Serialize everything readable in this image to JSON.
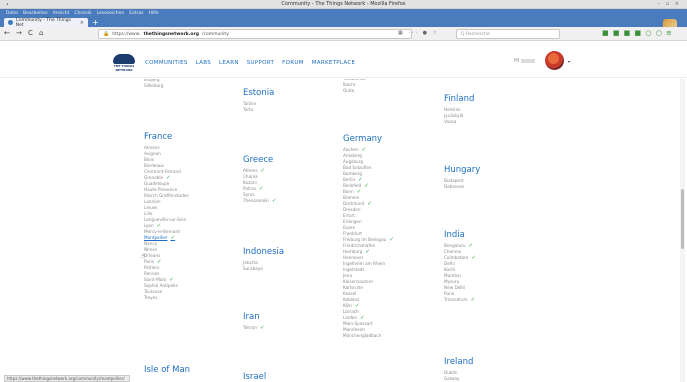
{
  "window": {
    "title": "Community - The Things Network - Mozilla Firefox",
    "controls": "– ▫ ×"
  },
  "menubar": {
    "items": [
      "Datei",
      "Bearbeiten",
      "Ansicht",
      "Chronik",
      "Lesezeichen",
      "Extras",
      "Hilfe"
    ]
  },
  "tab": {
    "label": "Community - The Things Net",
    "close": "×",
    "new": "+"
  },
  "navbar": {
    "back": "←",
    "forward": "→",
    "reload": "C",
    "home": "⌂",
    "url_prefix": "https://www.",
    "url_host": "thethingsnetwork.org",
    "url_path": "/community",
    "url_icons": "▦ ··· ● ☆",
    "search_placeholder": "Q Recherche",
    "tools": "■ ■ ■ ■ ○ ○ ≡"
  },
  "site": {
    "logo_text": "THE THINGS NETWORK",
    "nav": [
      "COMMUNITIES",
      "LABS",
      "LEARN",
      "SUPPORT",
      "FORUM",
      "MARKETPLACE"
    ],
    "user_greeting": "HI",
    "caret": "▾"
  },
  "columns": [
    {
      "blocks": [
        {
          "country": "",
          "cities": [
            {
              "name": "Esbjerg"
            },
            {
              "name": "Silkeborg"
            }
          ]
        },
        {
          "country": "France",
          "cities": [
            {
              "name": "Amiens"
            },
            {
              "name": "Avignon"
            },
            {
              "name": "Blois"
            },
            {
              "name": "Bordeaux"
            },
            {
              "name": "Clermont-Ferrand"
            },
            {
              "name": "Grenoble",
              "check": true
            },
            {
              "name": "Guadeloupe"
            },
            {
              "name": "Haute Provence"
            },
            {
              "name": "Illkirch Graffenstaden"
            },
            {
              "name": "Lannion"
            },
            {
              "name": "Lieues"
            },
            {
              "name": "Lille"
            },
            {
              "name": "Longueville-sur-Scie"
            },
            {
              "name": "Lyon",
              "check": true
            },
            {
              "name": "Mercy-le-Bernard"
            },
            {
              "name": "Montpellier",
              "check": true,
              "hl": true
            },
            {
              "name": "Nancy"
            },
            {
              "name": "Nîmes"
            },
            {
              "name": "Orleans"
            },
            {
              "name": "Paris",
              "check": true
            },
            {
              "name": "Poitiers"
            },
            {
              "name": "Rennes"
            },
            {
              "name": "Saint-Malo",
              "check": true
            },
            {
              "name": "Sophia Antipolis"
            },
            {
              "name": "Toulouse"
            },
            {
              "name": "Troyes"
            }
          ]
        },
        {
          "country": "Isle of Man",
          "cities": []
        }
      ]
    },
    {
      "blocks": [
        {
          "country": "Estonia",
          "cities": [
            {
              "name": "Tallinn"
            },
            {
              "name": "Tartu"
            }
          ]
        },
        {
          "country": "Greece",
          "cities": [
            {
              "name": "Athens",
              "check": true
            },
            {
              "name": "Chania"
            },
            {
              "name": "Kozani"
            },
            {
              "name": "Patras",
              "check": true
            },
            {
              "name": "Syros"
            },
            {
              "name": "Thessaloniki",
              "check": true
            }
          ]
        },
        {
          "country": "Indonesia",
          "cities": [
            {
              "name": "Jakarta"
            },
            {
              "name": "Surabaya"
            }
          ]
        },
        {
          "country": "Iran",
          "cities": [
            {
              "name": "Tehran",
              "check": true
            }
          ]
        },
        {
          "country": "Israel",
          "cities": []
        }
      ]
    },
    {
      "blocks": [
        {
          "country": "",
          "cities": [
            {
              "name": "Tessaloniki"
            },
            {
              "name": "Ibarra"
            },
            {
              "name": "Quito"
            }
          ]
        },
        {
          "country": "Germany",
          "cities": [
            {
              "name": "Aachen",
              "check": true
            },
            {
              "name": "Arnsberg"
            },
            {
              "name": "Augsburg"
            },
            {
              "name": "Bad Salzuflen"
            },
            {
              "name": "Bamberg"
            },
            {
              "name": "Berlin",
              "check": true
            },
            {
              "name": "Bielefeld",
              "check": true
            },
            {
              "name": "Bonn",
              "check": true
            },
            {
              "name": "Bremen"
            },
            {
              "name": "Dortmund",
              "check": true
            },
            {
              "name": "Dresden"
            },
            {
              "name": "Erfurt"
            },
            {
              "name": "Erlangen"
            },
            {
              "name": "Essen"
            },
            {
              "name": "Frankfurt"
            },
            {
              "name": "Freiburg im Breisgau",
              "check": true
            },
            {
              "name": "Friedrichshafen"
            },
            {
              "name": "Hamburg",
              "check": true
            },
            {
              "name": "Hannover"
            },
            {
              "name": "Ingelheim am Rhein"
            },
            {
              "name": "Ingolstadt"
            },
            {
              "name": "Jena"
            },
            {
              "name": "Kaiserslautern"
            },
            {
              "name": "Karlsruhe"
            },
            {
              "name": "Kassel"
            },
            {
              "name": "Koblenz"
            },
            {
              "name": "Köln",
              "check": true
            },
            {
              "name": "Lörrach"
            },
            {
              "name": "Linden",
              "check": true
            },
            {
              "name": "Main-Spessart"
            },
            {
              "name": "Mannheim"
            },
            {
              "name": "Mönchengladbach"
            }
          ]
        }
      ]
    },
    {
      "blocks": [
        {
          "country": "Finland",
          "cities": [
            {
              "name": "Helsinki"
            },
            {
              "name": "Jyväskylä"
            },
            {
              "name": "Vaasa"
            }
          ]
        },
        {
          "country": "Hungary",
          "cities": [
            {
              "name": "Budapest"
            },
            {
              "name": "Debrecen"
            }
          ]
        },
        {
          "country": "India",
          "cities": [
            {
              "name": "Bengaluru",
              "check": true
            },
            {
              "name": "Chennai"
            },
            {
              "name": "Coimbatore",
              "check": true
            },
            {
              "name": "Delhi"
            },
            {
              "name": "Kochi"
            },
            {
              "name": "Mumbai"
            },
            {
              "name": "Mysuru"
            },
            {
              "name": "New Delhi"
            },
            {
              "name": "Pune"
            },
            {
              "name": "Trivandrum",
              "check": true
            }
          ]
        },
        {
          "country": "Ireland",
          "cities": [
            {
              "name": "Dublin"
            },
            {
              "name": "Galway"
            }
          ]
        }
      ]
    }
  ],
  "statusbar": {
    "text": "https://www.thethingsnetwork.org/community/montpellier/"
  },
  "icons": {
    "check": "✓",
    "check_color": "#2aa640",
    "link_color": "#1d6ec0"
  }
}
